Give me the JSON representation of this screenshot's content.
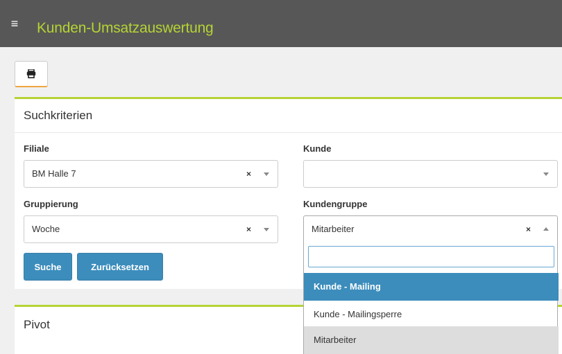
{
  "header": {
    "title": "Kunden-Umsatzauswertung",
    "menu_icon": "≡"
  },
  "toolbar": {
    "print_icon": "print-icon"
  },
  "search_panel": {
    "title": "Suchkriterien",
    "filiale": {
      "label": "Filiale",
      "value": "BM Halle 7",
      "clear": "×"
    },
    "kunde": {
      "label": "Kunde",
      "value": ""
    },
    "gruppierung": {
      "label": "Gruppierung",
      "value": "Woche",
      "clear": "×"
    },
    "kundengruppe": {
      "label": "Kundengruppe",
      "value": "Mitarbeiter",
      "clear": "×"
    },
    "buttons": {
      "search": "Suche",
      "reset": "Zurücksetzen"
    }
  },
  "dropdown": {
    "search_value": "",
    "options": [
      "Kunde - Mailing",
      "Kunde - Mailingsperre",
      "Mitarbeiter"
    ]
  },
  "pivot_panel": {
    "title": "Pivot"
  },
  "colors": {
    "accent": "#b5d334",
    "primary": "#3c8dbc",
    "topbar": "#575757"
  }
}
